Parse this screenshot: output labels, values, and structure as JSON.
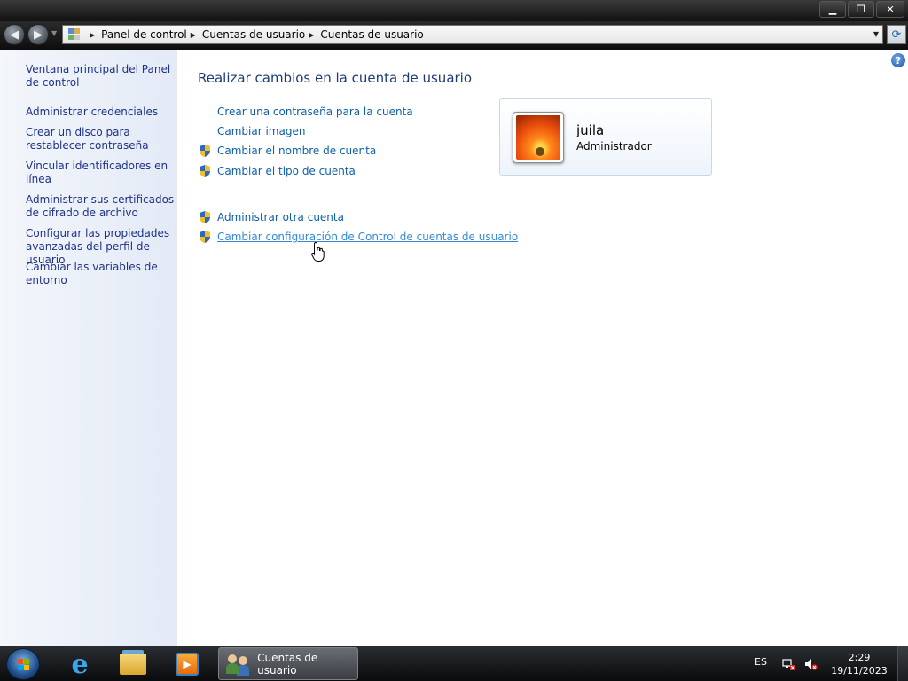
{
  "window": {
    "minimize_label": "▁",
    "maximize_label": "❐",
    "close_label": "✕"
  },
  "address": {
    "crumbs": [
      "Panel de control",
      "Cuentas de usuario",
      "Cuentas de usuario"
    ]
  },
  "sidebar": {
    "items": [
      {
        "label": "Ventana principal del Panel de control"
      },
      {
        "label": "Administrar credenciales"
      },
      {
        "label": "Crear un disco para restablecer contraseña"
      },
      {
        "label": "Vincular identificadores en línea"
      },
      {
        "label": "Administrar sus certificados de cifrado de archivo"
      },
      {
        "label": "Configurar las propiedades avanzadas del perfil de usuario"
      },
      {
        "label": "Cambiar las variables de entorno"
      }
    ]
  },
  "main": {
    "heading": "Realizar cambios en la cuenta de usuario",
    "tasks": [
      {
        "label": "Crear una contraseña para la cuenta",
        "shield": false
      },
      {
        "label": "Cambiar imagen",
        "shield": false
      },
      {
        "label": "Cambiar el nombre de cuenta",
        "shield": true
      },
      {
        "label": "Cambiar el tipo de cuenta",
        "shield": true
      },
      {
        "label": "Administrar otra cuenta",
        "shield": true
      },
      {
        "label": "Cambiar configuración de Control de cuentas de usuario",
        "shield": true
      }
    ],
    "user": {
      "name": "juila",
      "role": "Administrador"
    }
  },
  "taskbar": {
    "active_window": "Cuentas de usuario",
    "language": "ES",
    "time": "2:29",
    "date": "19/11/2023"
  },
  "icons": {
    "back": "back-arrow-icon",
    "forward": "forward-arrow-icon",
    "refresh": "refresh-icon",
    "help": "help-icon",
    "shield": "uac-shield-icon"
  },
  "colors": {
    "link": "#0f5fa8",
    "heading": "#1e3a7a",
    "sidebar_link": "#1e3287"
  }
}
